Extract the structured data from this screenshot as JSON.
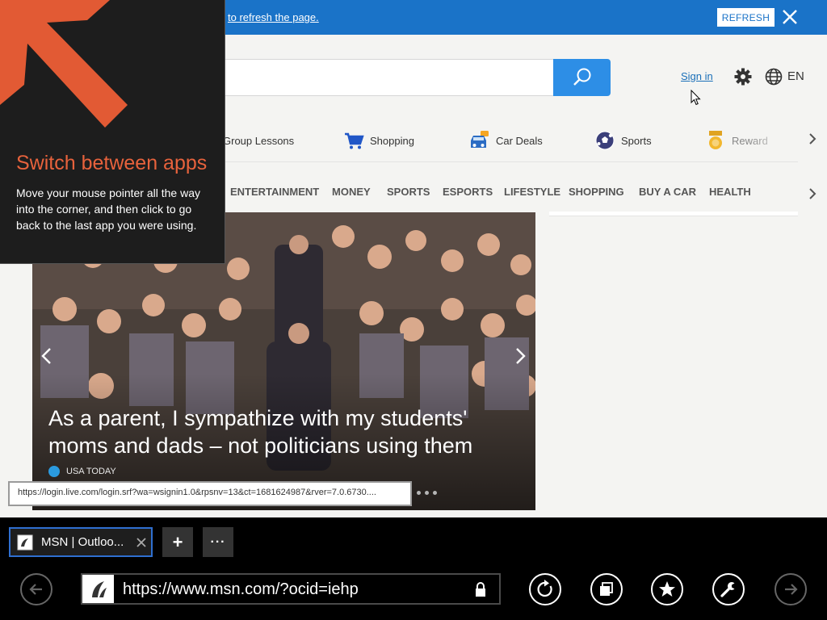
{
  "notification": {
    "message": "to refresh the page.",
    "refresh_label": "REFRESH"
  },
  "header": {
    "search_placeholder": "",
    "sign_in": "Sign in",
    "language": "EN"
  },
  "quick_links": [
    {
      "label": "Group Lessons",
      "icon": "lessons-icon"
    },
    {
      "label": "Shopping",
      "icon": "shopping-cart-icon"
    },
    {
      "label": "Car Deals",
      "icon": "car-icon"
    },
    {
      "label": "Sports",
      "icon": "soccer-ball-icon"
    },
    {
      "label": "Reward",
      "icon": "medal-icon"
    }
  ],
  "categories": [
    "ENTERTAINMENT",
    "MONEY",
    "SPORTS",
    "ESPORTS",
    "LIFESTYLE",
    "SHOPPING",
    "BUY A CAR",
    "HEALTH"
  ],
  "hero": {
    "headline": "As a parent, I sympathize with my students' moms and dads – not politicians using them",
    "source": "USA TODAY"
  },
  "link_preview": "https://login.live.com/login.srf?wa=wsignin1.0&rpsnv=13&ct=1681624987&rver=7.0.6730....",
  "tutorial": {
    "title": "Switch between apps",
    "body": "Move your mouse pointer all the way into the corner, and then click to go back to the last app you were using."
  },
  "browser": {
    "tab_title": "MSN | Outloo...",
    "new_tab": "+",
    "more": "···",
    "url": "https://www.msn.com/?ocid=iehp"
  },
  "colors": {
    "accent_blue": "#1a73c8",
    "search_blue": "#2d8ee6",
    "tutorial_orange": "#e7623c"
  }
}
